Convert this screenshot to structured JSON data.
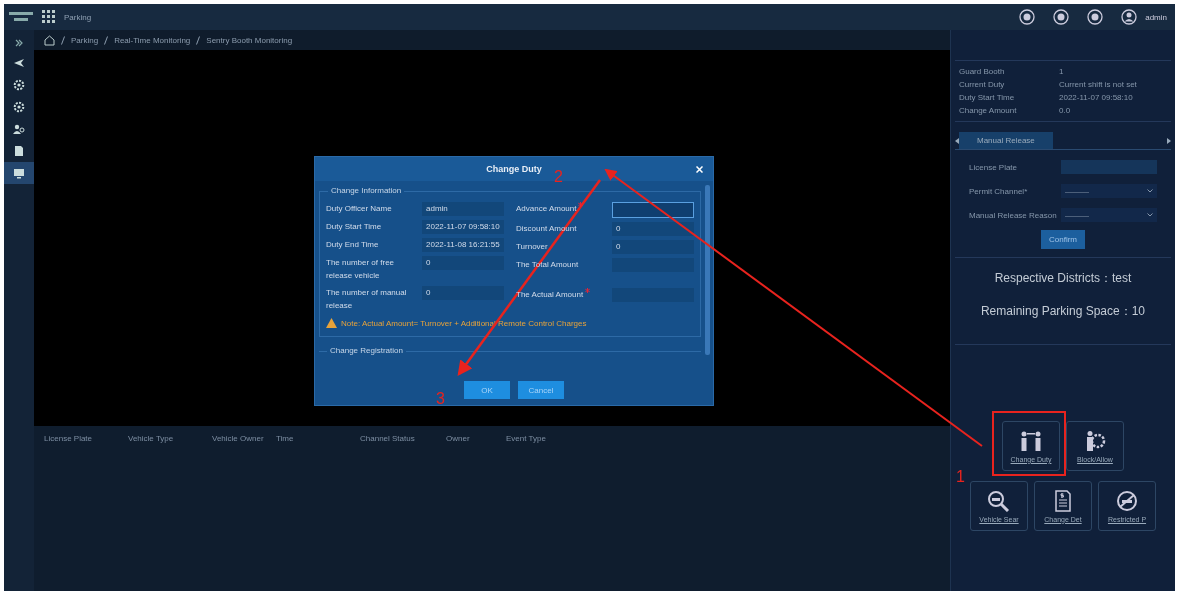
{
  "top_bar": {
    "app_name": "Parking",
    "user": "admin"
  },
  "breadcrumb": [
    "Parking",
    "Real-Time Monitoring",
    "Sentry Booth Monitoring"
  ],
  "sidebar": {
    "items": [
      {
        "kind": "plane",
        "selected": false
      },
      {
        "kind": "gear",
        "selected": false
      },
      {
        "kind": "cog",
        "selected": false
      },
      {
        "kind": "people",
        "selected": false
      },
      {
        "kind": "doc",
        "selected": false
      },
      {
        "kind": "monitor",
        "selected": true
      }
    ]
  },
  "table": {
    "columns": [
      "License Plate",
      "Vehicle Type",
      "Vehicle Owner",
      "Time",
      "Channel Status",
      "Owner",
      "Event Type"
    ]
  },
  "booth_info": [
    {
      "label": "Guard Booth",
      "value": "1"
    },
    {
      "label": "Current Duty",
      "value": "Current shift is not set"
    },
    {
      "label": "Duty Start Time",
      "value": "2022-11-07 09:58:10"
    },
    {
      "label": "Change Amount",
      "value": "0.0"
    }
  ],
  "tabs": [
    {
      "label": "Manual Release",
      "selected": true
    }
  ],
  "release_form": {
    "fields": [
      {
        "kind": "input",
        "label": "License Plate"
      },
      {
        "kind": "select",
        "label": "Permit Channel*",
        "value": "———"
      },
      {
        "kind": "select",
        "label": "Manual Release Reason",
        "value": "———"
      }
    ],
    "confirm": "Confirm"
  },
  "stats": [
    "Respective Districts：test",
    "Remaining Parking Space：10"
  ],
  "actions": [
    {
      "kind": "duty",
      "label": "Change Duty"
    },
    {
      "kind": "block",
      "label": "Block/Allow"
    },
    {
      "kind": "search",
      "label": "Vehicle Sear"
    },
    {
      "kind": "bill",
      "label": "Change Det"
    },
    {
      "kind": "restricted",
      "label": "Restricted P"
    }
  ],
  "dialog": {
    "title": "Change Duty",
    "section": "Change Information",
    "left": [
      {
        "label": "Duty Officer Name",
        "value": "admin"
      },
      {
        "label": "Duty Start Time",
        "value": "2022-11-07 09:58:10"
      },
      {
        "label": "Duty End Time",
        "value": "2022-11-08 16:21:55"
      },
      {
        "label": "The number of free release vehicle",
        "value": "0"
      },
      {
        "label": "The number of manual release",
        "value": "0"
      }
    ],
    "right": [
      {
        "label": "Advance Amount",
        "required": true,
        "focused": true
      },
      {
        "label": "Discount Amount",
        "value": "0",
        "required": false,
        "focused": false
      },
      {
        "label": "Turnover",
        "value": "0",
        "required": false,
        "focused": false
      },
      {
        "label": "The Total Amount",
        "required": false,
        "focused": false
      },
      {
        "label": "The Actual Amount",
        "required": true,
        "focused": false
      }
    ],
    "note": "Note: Actual Amount= Turnover + Additional Remote Control Charges",
    "section2": "Change Registration",
    "buttons": [
      "OK",
      "Cancel"
    ]
  },
  "annotations": [
    "1",
    "2",
    "3"
  ]
}
